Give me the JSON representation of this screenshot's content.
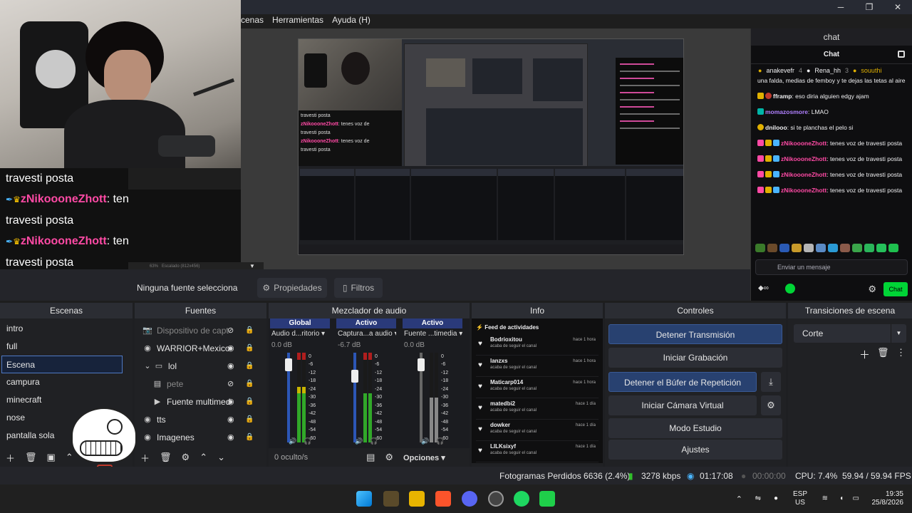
{
  "menubar": {
    "items": [
      "cenas",
      "Herramientas",
      "Ayuda (H)"
    ]
  },
  "window_controls": {
    "minimize": "─",
    "maximize": "❐",
    "close": "✕"
  },
  "overlay_chat": {
    "lines": [
      {
        "text": "travesti posta"
      },
      {
        "user": "zNikoooneZhott",
        "text": ": tenes voz de",
        "cont": "travesti posta"
      },
      {
        "user": "zNikoooneZhott",
        "text": ": tenes voz de",
        "cont": "travesti posta"
      }
    ]
  },
  "preview_status": {
    "zoom": "63%",
    "hint": "Escalado (812x456)"
  },
  "properties_bar": {
    "no_source": "Ninguna fuente selecciona",
    "properties": "Propiedades",
    "filters": "Filtros"
  },
  "twitch": {
    "window_title": "chat",
    "header": "Chat",
    "top_gifters": [
      {
        "name": "anakevefr",
        "count": "4"
      },
      {
        "name": "Rena_hh",
        "count": "3"
      },
      {
        "name": "souuthi",
        "count": ""
      }
    ],
    "messages": [
      {
        "user": "",
        "text": "una falda, medias de femboy y te dejas las tetas al aire",
        "color": ""
      },
      {
        "user": "fframp",
        "text": ": eso diria alguien edgy ajam",
        "color": ""
      },
      {
        "user": "momazosmore",
        "text": ": LMAO",
        "color": "violet"
      },
      {
        "user": "dnilooo",
        "text": ": si te planchas el pelo si",
        "color": ""
      },
      {
        "user": "zNikoooneZhott",
        "text": ": tenes voz de travesti posta",
        "color": "pink"
      },
      {
        "user": "zNikoooneZhott",
        "text": ": tenes voz de travesti posta",
        "color": "pink"
      },
      {
        "user": "zNikoooneZhott",
        "text": ": tenes voz de travesti posta",
        "color": "pink"
      },
      {
        "user": "zNikoooneZhott",
        "text": ": tenes voz de travesti posta",
        "color": "pink"
      }
    ],
    "input_placeholder": "Enviar un mensaje",
    "chat_button": "Chat"
  },
  "docks": {
    "scenes": {
      "title": "Escenas",
      "items": [
        "intro",
        "full",
        "Escena",
        "campura",
        "minecraft",
        "nose",
        "pantalla sola"
      ],
      "selected": 2
    },
    "sources": {
      "title": "Fuentes",
      "items": [
        {
          "name": "Dispositivo de capt",
          "icon": "camera-icon"
        },
        {
          "name": "WARRIOR+Mexico",
          "icon": "globe-icon"
        },
        {
          "name": "lol",
          "icon": "folder-icon"
        },
        {
          "name": "pete",
          "icon": "image-icon"
        },
        {
          "name": "Fuente multimed",
          "icon": "play-icon"
        },
        {
          "name": "tts",
          "icon": "globe-icon"
        },
        {
          "name": "Imagenes",
          "icon": "globe-icon"
        }
      ]
    },
    "mixer": {
      "title": "Mezclador de audio",
      "channels": [
        {
          "head": "Global",
          "name": "Audio d...ritorio",
          "db": "0.0 dB",
          "level": 0.62
        },
        {
          "head": "Activo",
          "name": "Captura...a audio",
          "db": "-6.7 dB",
          "level": 0.55
        },
        {
          "head": "Activo",
          "name": "Fuente ...timedia",
          "db": "0.0 dB",
          "level": 0.0
        }
      ],
      "scale": [
        "0",
        "-6",
        "-12",
        "-18",
        "-24",
        "-30",
        "-36",
        "-42",
        "-48",
        "-54",
        "-60"
      ],
      "hidden": "0 oculto/s",
      "options": "Opciones"
    },
    "info": {
      "title": "Info",
      "feed_title": "Feed de actividades",
      "items": [
        {
          "name": "Bodrioxitou",
          "action": "acaba de seguir el canal",
          "time": "hace 1 hora"
        },
        {
          "name": "lanzxs",
          "action": "acaba de seguir el canal",
          "time": "hace 1 hora"
        },
        {
          "name": "Maticarp014",
          "action": "acaba de seguir el canal",
          "time": "hace 1 hora"
        },
        {
          "name": "matedbi2",
          "action": "acaba de seguir el canal",
          "time": "hace 1 día"
        },
        {
          "name": "dowker",
          "action": "acaba de seguir el canal",
          "time": "hace 1 día"
        },
        {
          "name": "LILKsixyf",
          "action": "acaba de seguir el canal",
          "time": "hace 1 día"
        }
      ]
    },
    "controls": {
      "title": "Controles",
      "stop_stream": "Detener Transmisión",
      "start_recording": "Iniciar Grabación",
      "stop_replay": "Detener el Búfer de Repetición",
      "start_virtualcam": "Iniciar Cámara Virtual",
      "studio_mode": "Modo Estudio",
      "settings": "Ajustes"
    },
    "transitions": {
      "title": "Transiciones de escena",
      "selected": "Corte"
    }
  },
  "status": {
    "dropped": "Fotogramas Perdidos 6636 (2.4%)",
    "bitrate": "3278 kbps",
    "stream_time": "01:17:08",
    "rec_time": "00:00:00",
    "cpu": "CPU: 7.4%",
    "fps": "59.94 / 59.94 FPS"
  },
  "taskbar": {
    "lang": "ESP",
    "region": "US",
    "time": "19:35",
    "date": "25/8/2026"
  },
  "colors": {
    "accent": "#284170",
    "twitch_green": "#00d436",
    "chat_pink": "#ff4aa5"
  }
}
